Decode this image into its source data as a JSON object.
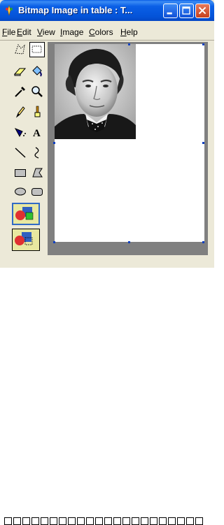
{
  "window": {
    "title": "Bitmap Image in table : T..."
  },
  "menu": {
    "items": [
      {
        "label": "File"
      },
      {
        "label": "Edit"
      },
      {
        "label": "View"
      },
      {
        "label": "Image"
      },
      {
        "label": "Colors"
      },
      {
        "label": "Help"
      }
    ]
  },
  "tools": [
    {
      "icon": "free-form-select-icon"
    },
    {
      "icon": "rect-select-icon",
      "selected": true
    },
    {
      "icon": "eraser-icon"
    },
    {
      "icon": "fill-bucket-icon"
    },
    {
      "icon": "color-picker-icon"
    },
    {
      "icon": "magnifier-icon"
    },
    {
      "icon": "pencil-icon"
    },
    {
      "icon": "brush-icon"
    },
    {
      "icon": "airbrush-icon"
    },
    {
      "icon": "text-icon",
      "glyph": "A"
    },
    {
      "icon": "line-icon"
    },
    {
      "icon": "curve-icon"
    },
    {
      "icon": "rectangle-icon"
    },
    {
      "icon": "polygon-icon"
    },
    {
      "icon": "ellipse-icon"
    },
    {
      "icon": "rounded-rect-icon"
    }
  ],
  "image": {
    "description_icon": "portrait-photo"
  }
}
